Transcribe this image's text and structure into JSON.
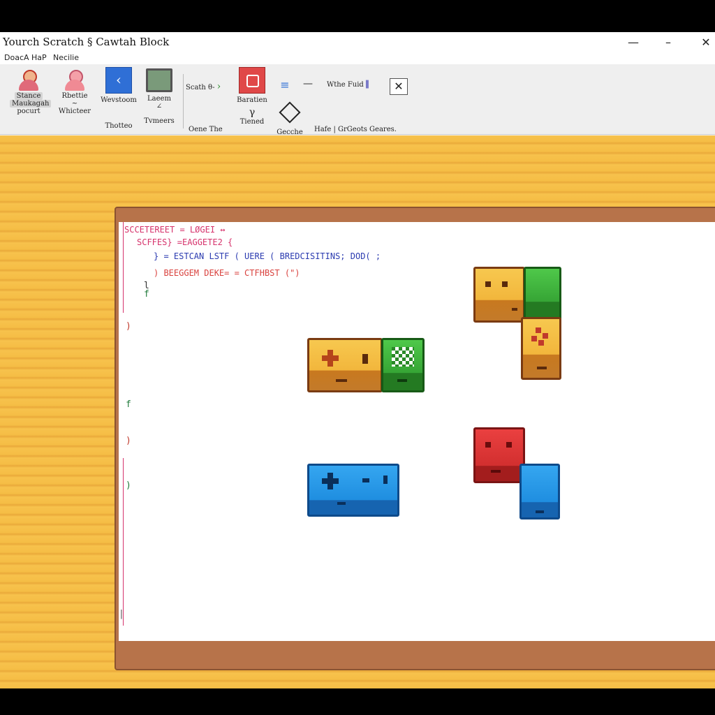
{
  "window": {
    "title": "Yourch Scratch § Cawtah Block",
    "controls": {
      "minimize": "—",
      "maximize": "–",
      "close": "✕"
    }
  },
  "menu": {
    "items": [
      "DoacA  HaP",
      "Necilie"
    ]
  },
  "ribbon": {
    "tools": [
      {
        "label1": "Stance",
        "label2": "Maukagah",
        "label3": "pocurt",
        "icon": "person-icon"
      },
      {
        "label1": "Rbettie",
        "label2": "~",
        "label3": "Whicteer",
        "icon": "person-pink-icon"
      },
      {
        "label1": "Wevstoom",
        "label2": "Thotteo",
        "icon": "blue-square-icon"
      },
      {
        "label1": "Laeem",
        "label2": "∠",
        "label3": "Tvmeers",
        "icon": "computer-icon"
      },
      {
        "label1": "Scath  θ-",
        "label2": "Oene  The",
        "icon": "chevron-right-icon"
      },
      {
        "label1": "Baratien",
        "label2": "γ",
        "label3": "Tiened",
        "icon": "red-square-icon"
      },
      {
        "label1": "≡",
        "icon": "list-icon"
      },
      {
        "label1": "—",
        "icon": "dash-icon"
      },
      {
        "label1": "Wthe Fuid",
        "label2": "▌",
        "icon": "bar-icon"
      },
      {
        "label1": "✕",
        "icon": "close-box-icon"
      },
      {
        "label1": "Gecche",
        "icon": "diamond-icon"
      },
      {
        "label1": "Hafe  |  GrGeots  Geares.",
        "icon": "text-tool"
      }
    ]
  },
  "code": {
    "lines": [
      {
        "text": "SCCETEREET  =  LØGEI  ↔",
        "color": "#d6336c"
      },
      {
        "text": "SCFFES}  =EAGGETE2  {",
        "color": "#d6336c"
      },
      {
        "text": "}  =  ESTCAN LSTF  (   UERE   (   BREDCISITINS;   DOD(  ;",
        "color": "#2b3bb0"
      },
      {
        "text": ")  BEEGGEM  DEKE=  =  CTFHBST  (\")",
        "color": "#d9423e"
      }
    ],
    "braces": [
      "l",
      "f",
      ")",
      "f",
      ")",
      ")",
      "|"
    ]
  },
  "blocks": {
    "colors": {
      "yellow": "#f2b63c",
      "green": "#36a535",
      "red": "#d22f2f",
      "blue": "#1f8ee0",
      "outline": "#7a3b12"
    }
  }
}
